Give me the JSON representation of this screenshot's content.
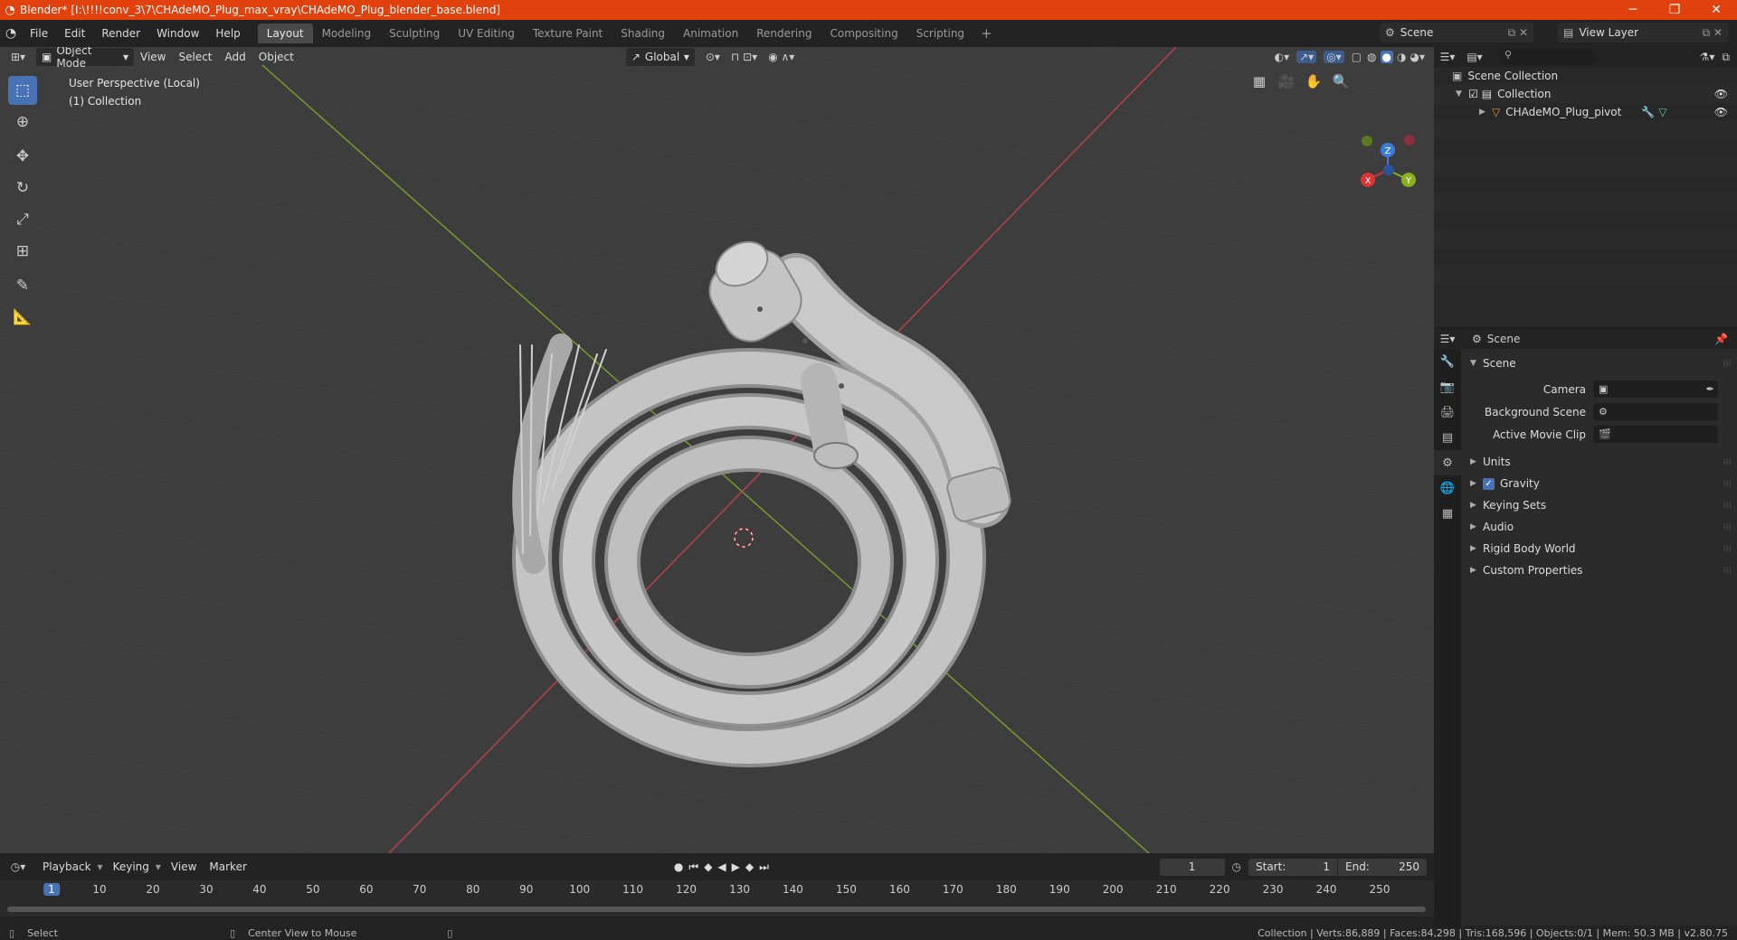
{
  "title": "Blender* [I:\\!!!!conv_3\\7\\CHAdeMO_Plug_max_vray\\CHAdeMO_Plug_blender_base.blend]",
  "menus": [
    "File",
    "Edit",
    "Render",
    "Window",
    "Help"
  ],
  "workspaces": [
    "Layout",
    "Modeling",
    "Sculpting",
    "UV Editing",
    "Texture Paint",
    "Shading",
    "Animation",
    "Rendering",
    "Compositing",
    "Scripting"
  ],
  "active_workspace": "Layout",
  "scene_name": "Scene",
  "view_layer": "View Layer",
  "viewport": {
    "mode": "Object Mode",
    "menus": [
      "View",
      "Select",
      "Add",
      "Object"
    ],
    "transform_orientation": "Global",
    "info_line1": "User Perspective (Local)",
    "info_line2": "(1) Collection",
    "gizmo": {
      "x": "X",
      "y": "Y",
      "z": "Z"
    }
  },
  "timeline": {
    "menus": [
      "Playback",
      "Keying",
      "View",
      "Marker"
    ],
    "current_frame": "1",
    "start_label": "Start:",
    "start": "1",
    "end_label": "End:",
    "end": "250",
    "ticks": [
      "1",
      "10",
      "20",
      "30",
      "40",
      "50",
      "60",
      "70",
      "80",
      "90",
      "100",
      "110",
      "120",
      "130",
      "140",
      "150",
      "160",
      "170",
      "180",
      "190",
      "200",
      "210",
      "220",
      "230",
      "240",
      "250"
    ]
  },
  "status": {
    "left_action": "Select",
    "mid_action": "Center View to Mouse",
    "right": "Collection | Verts:86,889 | Faces:84,298 | Tris:168,596 | Objects:0/1 | Mem: 50.3 MB | v2.80.75"
  },
  "outliner": {
    "root": "Scene Collection",
    "collection": "Collection",
    "object": "CHAdeMO_Plug_pivot"
  },
  "properties": {
    "context": "Scene",
    "panel_title": "Scene",
    "fields": [
      {
        "label": "Camera",
        "value": ""
      },
      {
        "label": "Background Scene",
        "value": ""
      },
      {
        "label": "Active Movie Clip",
        "value": ""
      }
    ],
    "sections": [
      "Units",
      "Gravity",
      "Keying Sets",
      "Audio",
      "Rigid Body World",
      "Custom Properties"
    ]
  },
  "colors": {
    "accent": "#4772b3",
    "titlebar": "#e0410d",
    "axis_x": "#b5414b",
    "axis_y": "#7b9a2a",
    "mesh": "#bdbdbd"
  }
}
